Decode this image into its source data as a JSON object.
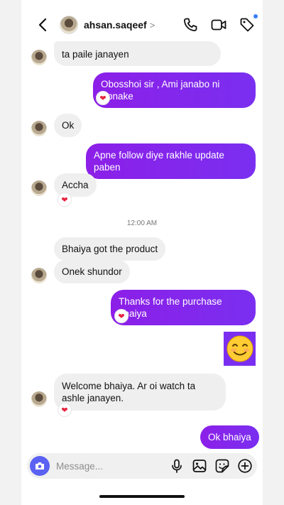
{
  "header": {
    "username": "ahsan.saqeef",
    "chevron": ">"
  },
  "icons": {
    "back": "chevron-left-icon",
    "call": "phone-icon",
    "video": "video-camera-icon",
    "tag": "tag-icon",
    "camera": "camera-icon",
    "mic": "microphone-icon",
    "gallery": "image-icon",
    "sticker": "sticker-icon",
    "add": "plus-circle-icon"
  },
  "messages": [
    {
      "from": "them",
      "text": "ta paile janayen"
    },
    {
      "from": "me",
      "text": "Obosshoi sir , Ami janabo ni Apnake",
      "reaction": "❤"
    },
    {
      "from": "them",
      "text": "Ok"
    },
    {
      "from": "me",
      "text": "Apne follow diye rakhle update paben"
    },
    {
      "from": "them",
      "text": "Accha",
      "reaction": "❤"
    },
    {
      "from": "them",
      "text": "Bhaiya got the product"
    },
    {
      "from": "them",
      "text": "Onek shundor"
    },
    {
      "from": "me",
      "text": "Thanks for the purchase bhaiya",
      "reaction": "❤"
    },
    {
      "from": "me",
      "text": "😊"
    },
    {
      "from": "them",
      "text": "Welcome bhaiya. Ar oi watch ta ashle janayen.",
      "reaction": "❤"
    },
    {
      "from": "me",
      "text": "Ok bhaiya"
    }
  ],
  "timestamp": "12:00 AM",
  "composer": {
    "placeholder": "Message..."
  },
  "colors": {
    "outgoing": "#8a24e6",
    "incoming": "#efefef",
    "camera_button": "#5b61f2"
  }
}
